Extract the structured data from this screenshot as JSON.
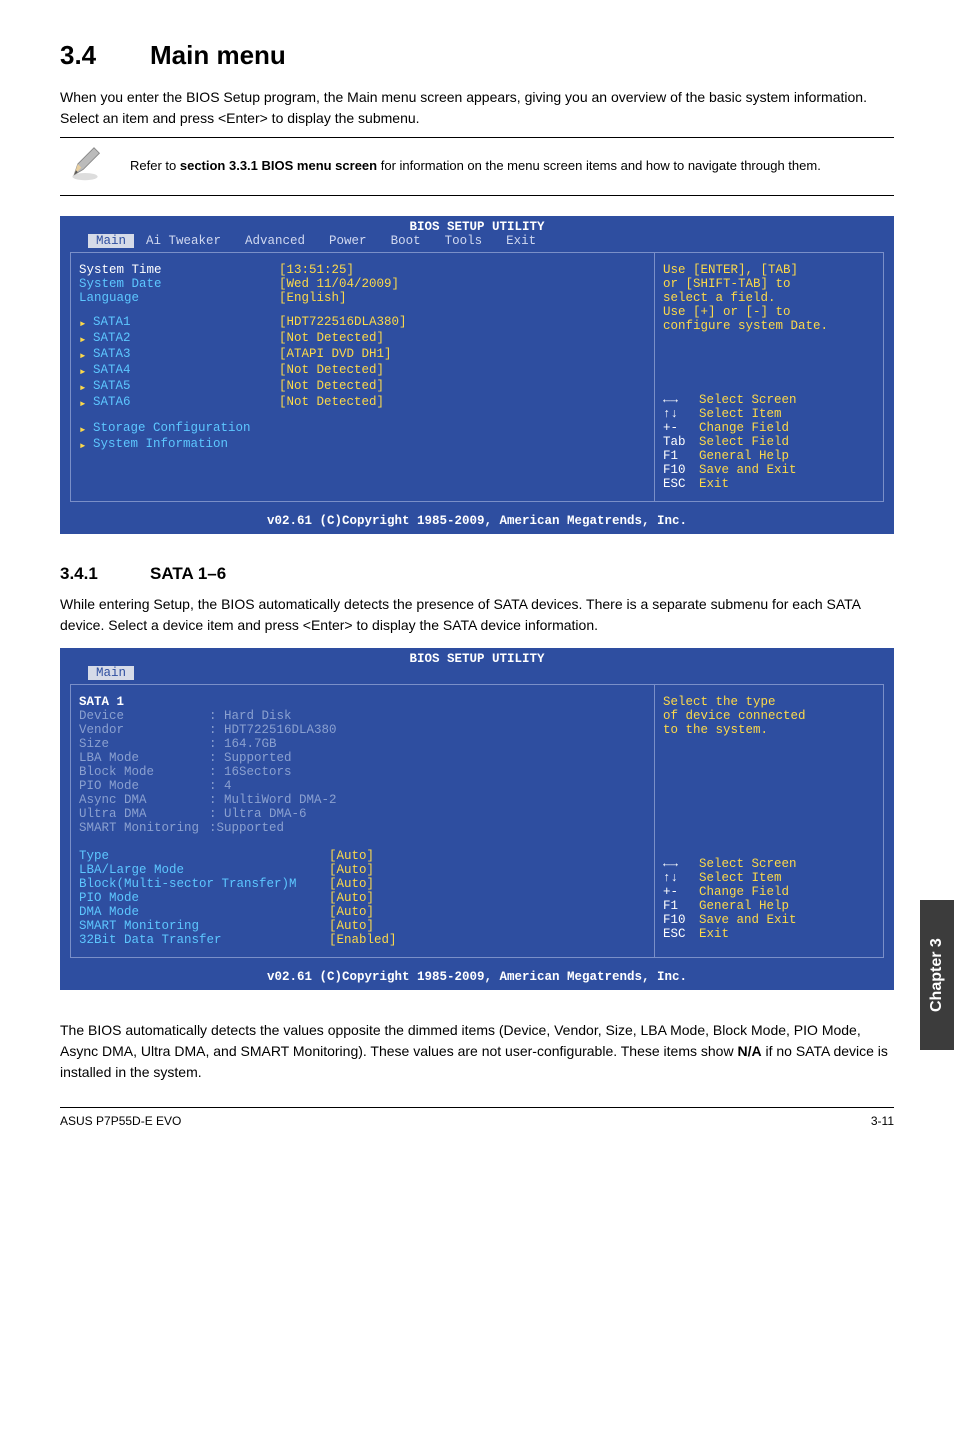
{
  "section": {
    "number": "3.4",
    "title": "Main menu",
    "intro": "When you enter the BIOS Setup program, the Main menu screen appears, giving you an overview of the basic system information. Select an item and press <Enter> to display the submenu."
  },
  "note": {
    "text_prefix": "Refer to ",
    "text_bold": "section 3.3.1 BIOS menu screen",
    "text_suffix": " for information on the menu screen items and how to navigate through them."
  },
  "bios1": {
    "header": "BIOS SETUP UTILITY",
    "tabs": [
      "Main",
      "Ai Tweaker",
      "Advanced",
      "Power",
      "Boot",
      "Tools",
      "Exit"
    ],
    "items": [
      {
        "label": "System Time",
        "value": "[13:51:25]",
        "highlight": true
      },
      {
        "label": "System Date",
        "value": "[Wed 11/04/2009]"
      },
      {
        "label": "Language",
        "value": "[English]"
      }
    ],
    "sata": [
      {
        "label": "SATA1",
        "value": "[HDT722516DLA380]"
      },
      {
        "label": "SATA2",
        "value": "[Not Detected]"
      },
      {
        "label": "SATA3",
        "value": "[ATAPI DVD DH1]"
      },
      {
        "label": "SATA4",
        "value": "[Not Detected]"
      },
      {
        "label": "SATA5",
        "value": "[Not Detected]"
      },
      {
        "label": "SATA6",
        "value": "[Not Detected]"
      }
    ],
    "submenus": [
      {
        "label": "Storage Configuration"
      },
      {
        "label": "System Information"
      }
    ],
    "help_top": [
      "Use [ENTER], [TAB]",
      "or [SHIFT-TAB] to",
      "select a field.",
      "",
      "Use [+] or [-] to",
      "configure system Date."
    ],
    "help_keys": [
      {
        "k": "←→",
        "v": "Select Screen"
      },
      {
        "k": "↑↓",
        "v": "Select Item"
      },
      {
        "k": "+-",
        "v": "Change Field"
      },
      {
        "k": "Tab",
        "v": "Select Field"
      },
      {
        "k": "F1",
        "v": "General Help"
      },
      {
        "k": "F10",
        "v": "Save and Exit"
      },
      {
        "k": "ESC",
        "v": "Exit"
      }
    ],
    "copyright": "v02.61 (C)Copyright 1985-2009, American Megatrends, Inc."
  },
  "subsection": {
    "number": "3.4.1",
    "title": "SATA 1–6",
    "intro": "While entering Setup, the BIOS automatically detects the presence of SATA devices. There is a separate submenu for each SATA device. Select a device item and press <Enter> to display the SATA device information."
  },
  "bios2": {
    "header": "BIOS SETUP UTILITY",
    "tab": "Main",
    "heading": "SATA 1",
    "info": [
      {
        "label": "Device",
        "value": ": Hard Disk"
      },
      {
        "label": "Vendor",
        "value": ": HDT722516DLA380"
      },
      {
        "label": "Size",
        "value": ": 164.7GB"
      },
      {
        "label": "LBA Mode",
        "value": ": Supported"
      },
      {
        "label": "Block Mode",
        "value": ": 16Sectors"
      },
      {
        "label": "PIO Mode",
        "value": ": 4"
      },
      {
        "label": "Async DMA",
        "value": ": MultiWord DMA-2"
      },
      {
        "label": "Ultra DMA",
        "value": ": Ultra DMA-6"
      },
      {
        "label": "SMART Monitoring",
        "value": ":Supported",
        "nowrap": true
      }
    ],
    "options": [
      {
        "label": "Type",
        "value": "[Auto]"
      },
      {
        "label": "LBA/Large Mode",
        "value": "[Auto]"
      },
      {
        "label": "Block(Multi-sector Transfer)M",
        "value": "[Auto]"
      },
      {
        "label": "PIO Mode",
        "value": "[Auto]"
      },
      {
        "label": "DMA Mode",
        "value": "[Auto]"
      },
      {
        "label": "SMART Monitoring",
        "value": "[Auto]"
      },
      {
        "label": "32Bit Data Transfer",
        "value": "[Enabled]"
      }
    ],
    "help_top": [
      "Select the type",
      "of device connected",
      "to the system."
    ],
    "help_keys": [
      {
        "k": "←→",
        "v": "Select Screen"
      },
      {
        "k": "↑↓",
        "v": "Select Item"
      },
      {
        "k": "+-",
        "v": "Change Field"
      },
      {
        "k": "F1",
        "v": "General Help"
      },
      {
        "k": "F10",
        "v": "Save and Exit"
      },
      {
        "k": "ESC",
        "v": "Exit"
      }
    ],
    "copyright": "v02.61 (C)Copyright 1985-2009, American Megatrends, Inc."
  },
  "closing": {
    "p1a": "The BIOS automatically detects the values opposite the dimmed items (Device, Vendor, Size, LBA Mode, Block Mode, PIO Mode, Async DMA, Ultra DMA, and SMART Monitoring). These values are not user-configurable. These items show ",
    "p1b": "N/A",
    "p1c": " if no SATA device is installed in the system."
  },
  "sidebar": "Chapter 3",
  "footer": {
    "left": "ASUS P7P55D-E EVO",
    "right": "3-11"
  }
}
